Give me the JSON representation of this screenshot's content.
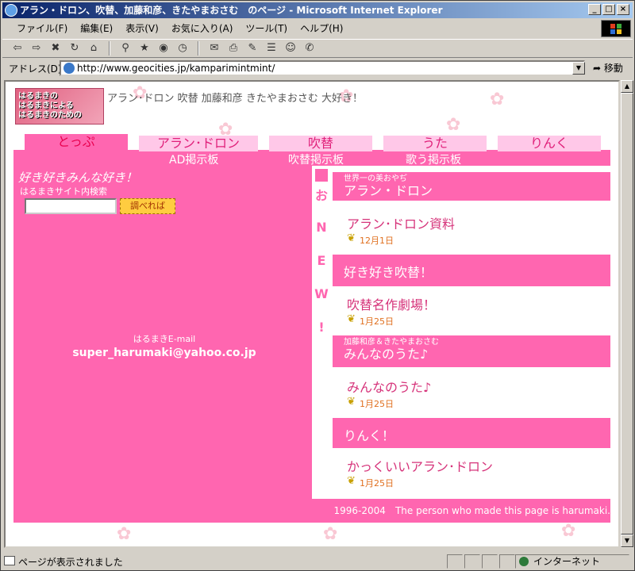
{
  "window": {
    "title": "アラン・ドロン、吹替、加藤和彦、きたやまおさむ　のページ - Microsoft Internet Explorer",
    "buttons": [
      "_",
      "□",
      "×"
    ]
  },
  "menu": [
    "ファイル(F)",
    "編集(E)",
    "表示(V)",
    "お気に入り(A)",
    "ツール(T)",
    "ヘルプ(H)"
  ],
  "address": {
    "label": "アドレス(D)",
    "url": "http://www.geocities.jp/kamparimintmint/",
    "go_label": "移動"
  },
  "status": {
    "text": "ページが表示されました",
    "zone": "インターネット"
  },
  "page": {
    "logo_lines": [
      "はるまきの",
      "はるまきによる",
      "はるまきのための"
    ],
    "tagline": "アラン･ドロン 吹替 加藤和彦 きたやまおさむ 大好き！",
    "tabs": [
      "とっぷ",
      "アラン･ドロン",
      "吹替",
      "うた",
      "りんく"
    ],
    "sublinks": [
      "AD掲示板",
      "吹替掲示板",
      "歌う掲示板"
    ],
    "left_title": "好き好きみんな好き！",
    "search_label": "はるまきサイト内検索",
    "search_button": "調べれば",
    "email_label": "はるまきE-mail",
    "email": "super_harumaki@yahoo.co.jp",
    "new_chars": [
      "お",
      "N",
      "E",
      "W",
      "!"
    ],
    "sections": [
      {
        "small": "世界一の美おやぢ",
        "heading": "アラン・ドロン",
        "item": "アラン･ドロン資料",
        "date": "12月1日"
      },
      {
        "small": "",
        "heading": "好き好き吹替！",
        "item": "吹替名作劇場！",
        "date": "1月25日"
      },
      {
        "small": "加藤和彦＆きたやまおさむ",
        "heading": "みんなのうた♪",
        "item": "みんなのうた♪",
        "date": "1月25日"
      },
      {
        "small": "",
        "heading": "りんく！",
        "item": "かっくいいアラン･ドロン",
        "date": "1月25日"
      }
    ],
    "footer": "1996-2004　The person who made this page is harumaki."
  },
  "colors": {
    "pink": "#ff66b0",
    "tab_bg": "#ffc8e8",
    "tab_text": "#e0207a"
  }
}
